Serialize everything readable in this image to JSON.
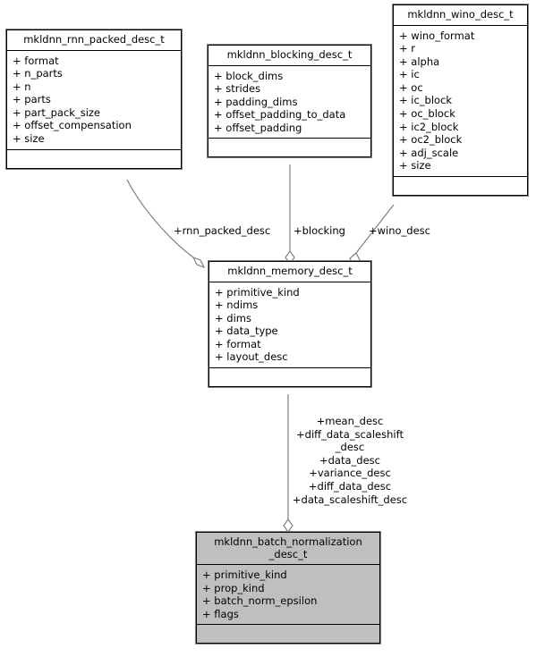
{
  "diagram": {
    "type": "uml-class-diagram",
    "background_color": "#ffffff",
    "line_color": "#808080",
    "border_color": "#000000",
    "highlight_fill": "#bfbfbf"
  },
  "classes": [
    {
      "id": "rnn_packed",
      "name": "mkldnn_rnn_packed_desc_t",
      "filled": false,
      "attributes": [
        "+ format",
        "+ n_parts",
        "+ n",
        "+ parts",
        "+ part_pack_size",
        "+ offset_compensation",
        "+ size"
      ],
      "methods": []
    },
    {
      "id": "blocking",
      "name": "mkldnn_blocking_desc_t",
      "filled": false,
      "attributes": [
        "+ block_dims",
        "+ strides",
        "+ padding_dims",
        "+ offset_padding_to_data",
        "+ offset_padding"
      ],
      "methods": []
    },
    {
      "id": "wino",
      "name": "mkldnn_wino_desc_t",
      "filled": false,
      "attributes": [
        "+ wino_format",
        "+ r",
        "+ alpha",
        "+ ic",
        "+ oc",
        "+ ic_block",
        "+ oc_block",
        "+ ic2_block",
        "+ oc2_block",
        "+ adj_scale",
        "+ size"
      ],
      "methods": []
    },
    {
      "id": "memory",
      "name": "mkldnn_memory_desc_t",
      "filled": false,
      "attributes": [
        "+ primitive_kind",
        "+ ndims",
        "+ dims",
        "+ data_type",
        "+ format",
        "+ layout_desc"
      ],
      "methods": []
    },
    {
      "id": "batchnorm",
      "name": "mkldnn_batch_normalization\n_desc_t",
      "filled": true,
      "attributes": [
        "+ primitive_kind",
        "+ prop_kind",
        "+ batch_norm_epsilon",
        "+ flags"
      ],
      "methods": []
    }
  ],
  "edges": [
    {
      "id": "edge-rnn-packed",
      "from": "rnn_packed",
      "to": "memory",
      "label": "+rnn_packed_desc",
      "marker": "open-diamond"
    },
    {
      "id": "edge-blocking",
      "from": "blocking",
      "to": "memory",
      "label": "+blocking",
      "marker": "open-diamond"
    },
    {
      "id": "edge-wino",
      "from": "wino",
      "to": "memory",
      "label": "+wino_desc",
      "marker": "open-diamond"
    },
    {
      "id": "edge-memory-batchnorm",
      "from": "memory",
      "to": "batchnorm",
      "label": "+mean_desc\n+diff_data_scaleshift\n_desc\n+data_desc\n+variance_desc\n+diff_data_desc\n+data_scaleshift_desc",
      "marker": "open-diamond"
    }
  ]
}
